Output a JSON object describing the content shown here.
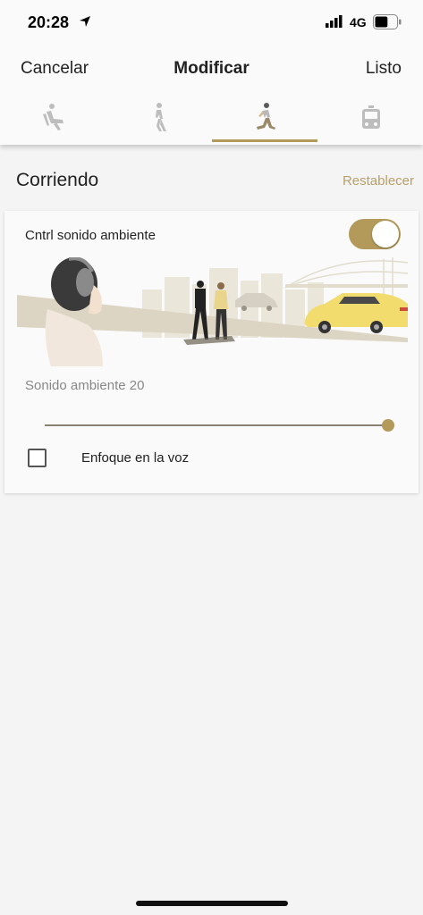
{
  "status_bar": {
    "time": "20:28",
    "network": "4G",
    "battery_level": 0.6
  },
  "nav": {
    "cancel_label": "Cancelar",
    "title": "Modificar",
    "done_label": "Listo"
  },
  "modes": [
    {
      "icon": "sitting-icon",
      "active": false
    },
    {
      "icon": "walking-icon",
      "active": false
    },
    {
      "icon": "running-icon",
      "active": true
    },
    {
      "icon": "transport-icon",
      "active": false
    }
  ],
  "section": {
    "title": "Corriendo",
    "reset_label": "Restablecer"
  },
  "ambient_card": {
    "toggle_label": "Cntrl sonido ambiente",
    "toggle_on": true,
    "ambient_level_label": "Sonido ambiente 20",
    "ambient_level": 20,
    "ambient_max": 20,
    "voice_focus_label": "Enfoque en la voz",
    "voice_focus_checked": false
  },
  "colors": {
    "accent": "#b39a5a",
    "link": "#b8a06a",
    "background": "#f4f4f4"
  }
}
